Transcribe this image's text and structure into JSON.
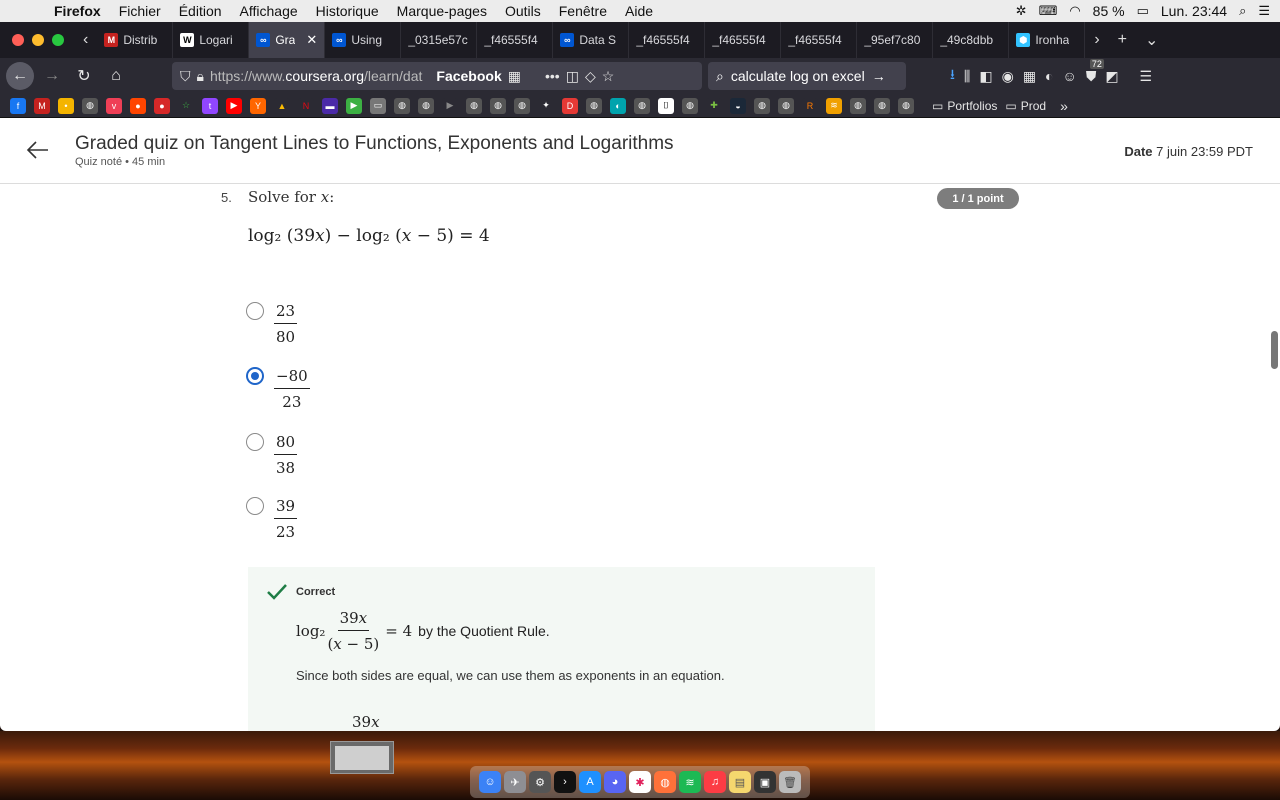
{
  "menubar": {
    "app": "Firefox",
    "items": [
      "Fichier",
      "Édition",
      "Affichage",
      "Historique",
      "Marque-pages",
      "Outils",
      "Fenêtre",
      "Aide"
    ],
    "battery": "85 %",
    "clock": "Lun. 23:44"
  },
  "tabs": [
    {
      "title": "Distrib",
      "icon": "gmail-icon",
      "color": "#c5221f",
      "glyph": "M"
    },
    {
      "title": "Logari",
      "icon": "wikipedia-icon",
      "color": "#ffffff",
      "glyph": "W"
    },
    {
      "title": "Gra",
      "icon": "coursera-icon",
      "color": "#0056d2",
      "glyph": "∞",
      "active": true
    },
    {
      "title": "Using",
      "icon": "coursera-icon",
      "color": "#0056d2",
      "glyph": "∞"
    },
    {
      "title": "_0315e57c",
      "icon": "none",
      "color": "",
      "glyph": ""
    },
    {
      "title": "_f46555f4",
      "icon": "none",
      "color": "",
      "glyph": ""
    },
    {
      "title": "Data S",
      "icon": "coursera-icon",
      "color": "#0056d2",
      "glyph": "∞"
    },
    {
      "title": "_f46555f4",
      "icon": "none",
      "color": "",
      "glyph": ""
    },
    {
      "title": "_f46555f4",
      "icon": "none",
      "color": "",
      "glyph": ""
    },
    {
      "title": "_f46555f4",
      "icon": "none",
      "color": "",
      "glyph": ""
    },
    {
      "title": "_95ef7c80",
      "icon": "none",
      "color": "",
      "glyph": ""
    },
    {
      "title": "_49c8dbb",
      "icon": "none",
      "color": "",
      "glyph": ""
    },
    {
      "title": "Ironha",
      "icon": "ironhack-icon",
      "color": "#32c3ff",
      "glyph": "⬢"
    }
  ],
  "nav": {
    "url_prefix": "https://www.",
    "url_domain": "coursera.org",
    "url_path": "/learn/dat",
    "page_label": "Facebook",
    "search_text": "calculate log on excel",
    "badge_count": "72"
  },
  "bookmarks": {
    "folders": [
      "Portfolios",
      "Prod"
    ]
  },
  "quiz": {
    "title": "Graded quiz on Tangent Lines to Functions, Exponents and Logarithms",
    "subtitle": "Quiz noté • 45  min",
    "due_label": "Date",
    "due_value": "7 juin 23:59 PDT"
  },
  "question": {
    "number": "5.",
    "text": "Solve for 𝑥:",
    "points": "1 / 1 point",
    "equation": "log₂ (39𝑥) − log₂ (𝑥 − 5) = 4",
    "options": [
      {
        "num": "23",
        "den": "80",
        "selected": false
      },
      {
        "num": "−80",
        "den": "23",
        "selected": true
      },
      {
        "num": "80",
        "den": "38",
        "selected": false
      },
      {
        "num": "39",
        "den": "23",
        "selected": false
      }
    ]
  },
  "feedback": {
    "status": "Correct",
    "eq_log": "log₂",
    "eq_num": "39𝑥",
    "eq_den": "(𝑥 − 5)",
    "eq_rhs": "= 4",
    "rule": "by the Quotient Rule.",
    "text": "Since both sides are equal, we can use them as exponents in an equation.",
    "eq2_num": "39𝑥"
  }
}
